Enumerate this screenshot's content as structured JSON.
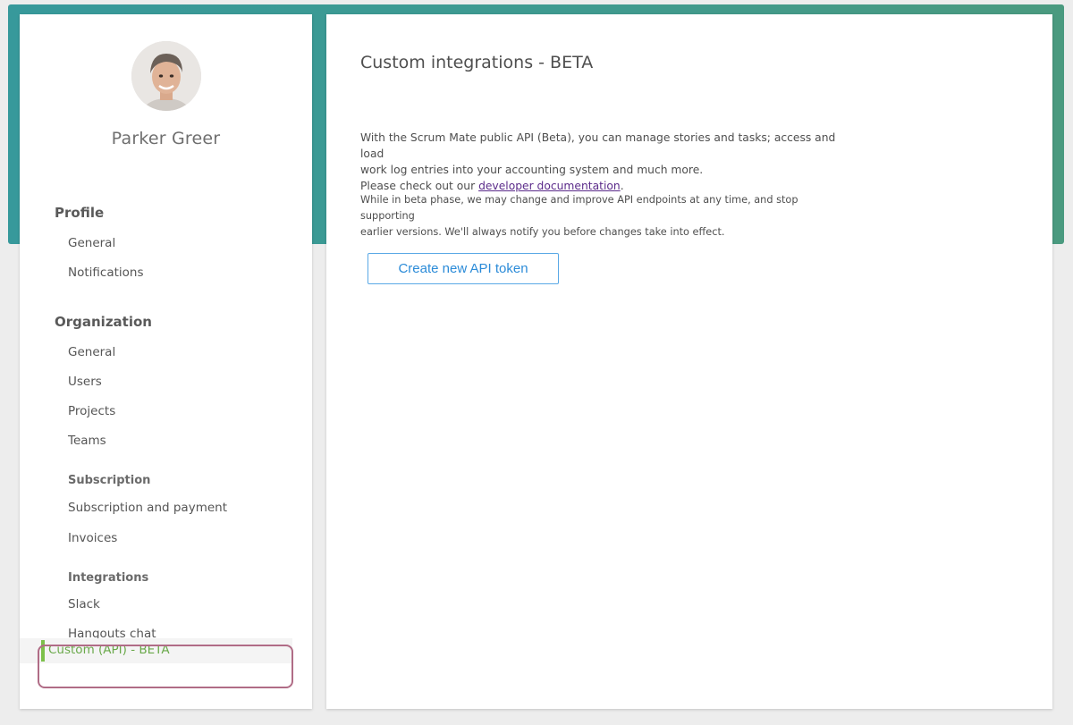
{
  "user": {
    "name": "Parker Greer"
  },
  "sidebar": {
    "profile": {
      "title": "Profile",
      "items": [
        {
          "label": "General"
        },
        {
          "label": "Notifications"
        }
      ]
    },
    "organization": {
      "title": "Organization",
      "items": [
        {
          "label": "General"
        },
        {
          "label": "Users"
        },
        {
          "label": "Projects"
        },
        {
          "label": "Teams"
        }
      ]
    },
    "subscription": {
      "title": "Subscription",
      "items": [
        {
          "label": "Subscription and payment"
        },
        {
          "label": "Invoices"
        }
      ]
    },
    "integrations": {
      "title": "Integrations",
      "items": [
        {
          "label": "Slack"
        },
        {
          "label": "Hangouts chat"
        },
        {
          "label": "Custom (API) - BETA"
        }
      ]
    }
  },
  "main": {
    "title": "Custom integrations - BETA",
    "intro_line1": "With the Scrum Mate public API (Beta), you can manage stories and tasks; access and load",
    "intro_line2": "work log entries into your accounting system and much more.",
    "intro_prefix": "Please check out our ",
    "doc_link": "developer documentation",
    "intro_suffix": ".",
    "beta_line1": "While in beta phase, we may change and improve API endpoints at any time, and stop supporting",
    "beta_line2": "earlier versions. We'll always notify you before changes take into effect.",
    "create_button": "Create new API token"
  },
  "colors": {
    "header": "#3a9a94",
    "active": "#7cc04a",
    "button": "#2b8bd8",
    "link": "#5b2b8a",
    "highlight": "#b06c86"
  }
}
